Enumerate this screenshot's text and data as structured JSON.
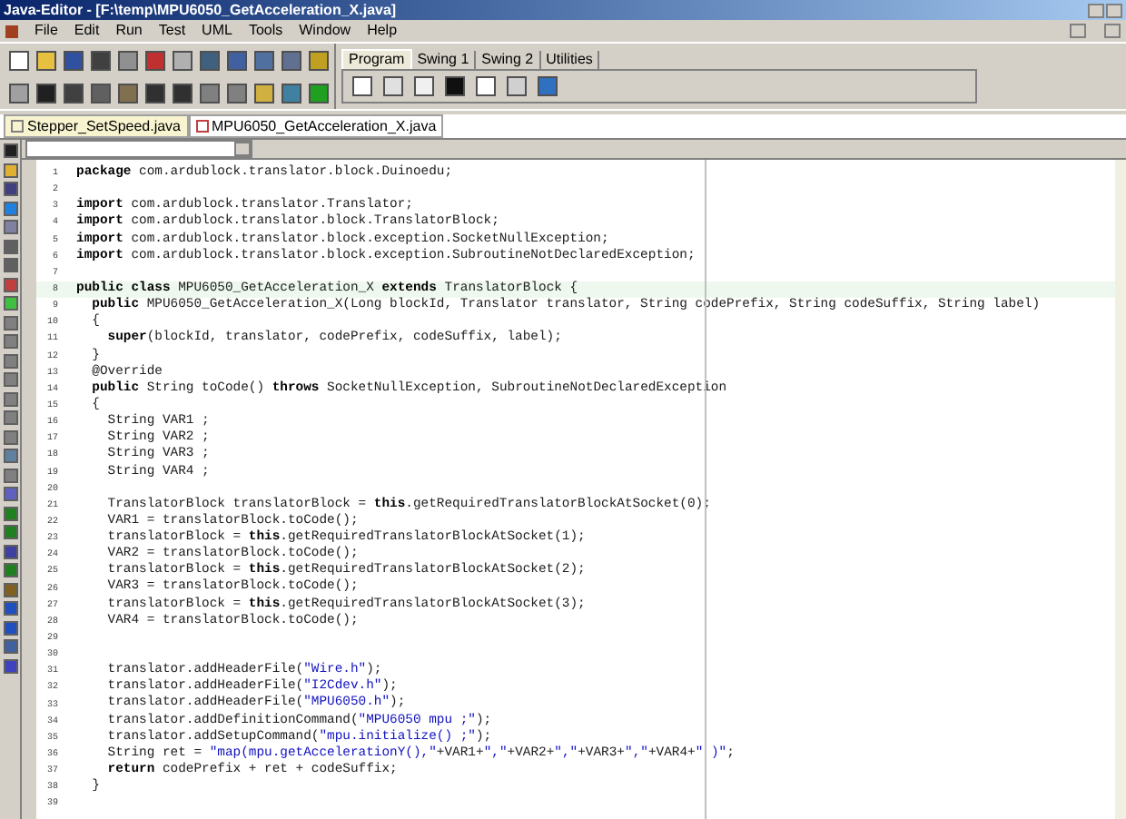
{
  "window": {
    "title": "Java-Editor - [F:\\temp\\MPU6050_GetAcceleration_X.java]"
  },
  "menu": [
    "File",
    "Edit",
    "Run",
    "Test",
    "UML",
    "Tools",
    "Window",
    "Help"
  ],
  "palette_tabs": [
    {
      "label": "Program",
      "selected": true
    },
    {
      "label": "Swing 1",
      "selected": false
    },
    {
      "label": "Swing 2",
      "selected": false
    },
    {
      "label": "Utilities",
      "selected": false
    }
  ],
  "file_tabs": [
    {
      "label": "Stepper_SetSpeed.java",
      "selected": false
    },
    {
      "label": "MPU6050_GetAcceleration_X.java",
      "selected": true
    }
  ],
  "code": [
    {
      "n": "1",
      "segs": [
        {
          "kind": "kw",
          "text": "package"
        },
        {
          "kind": "plain",
          "text": " com.ardublock.translator.block.Duinoedu;"
        }
      ]
    },
    {
      "n": "2"
    },
    {
      "n": "3",
      "segs": [
        {
          "kind": "kw",
          "text": "import"
        },
        {
          "kind": "plain",
          "text": " com.ardublock.translator.Translator;"
        }
      ]
    },
    {
      "n": "4",
      "segs": [
        {
          "kind": "kw",
          "text": "import"
        },
        {
          "kind": "plain",
          "text": " com.ardublock.translator.block.TranslatorBlock;"
        }
      ]
    },
    {
      "n": "5",
      "segs": [
        {
          "kind": "kw",
          "text": "import"
        },
        {
          "kind": "plain",
          "text": " com.ardublock.translator.block.exception.SocketNullException;"
        }
      ]
    },
    {
      "n": "6",
      "segs": [
        {
          "kind": "kw",
          "text": "import"
        },
        {
          "kind": "plain",
          "text": " com.ardublock.translator.block.exception.SubroutineNotDeclaredException;"
        }
      ]
    },
    {
      "n": "7"
    },
    {
      "n": "8",
      "segs": [
        {
          "kind": "kw",
          "text": "public class"
        },
        {
          "kind": "plain",
          "text": " MPU6050_GetAcceleration_X "
        },
        {
          "kind": "kw",
          "text": "extends"
        },
        {
          "kind": "plain",
          "text": " TranslatorBlock {"
        }
      ]
    },
    {
      "n": "9",
      "segs": [
        {
          "kind": "kw",
          "text": "  public"
        },
        {
          "kind": "plain",
          "text": " MPU6050_GetAcceleration_X(Long blockId, Translator translator, String codePrefix, String codeSuffix, String label)"
        }
      ]
    },
    {
      "n": "10",
      "segs": [
        {
          "kind": "plain",
          "text": "  {"
        }
      ]
    },
    {
      "n": "11",
      "segs": [
        {
          "kind": "kw",
          "text": "    super"
        },
        {
          "kind": "plain",
          "text": "(blockId, translator, codePrefix, codeSuffix, label);"
        }
      ]
    },
    {
      "n": "12",
      "segs": [
        {
          "kind": "plain",
          "text": "  }"
        }
      ]
    },
    {
      "n": "13",
      "segs": [
        {
          "kind": "plain",
          "text": "  @Override"
        }
      ]
    },
    {
      "n": "14",
      "segs": [
        {
          "kind": "kw",
          "text": "  public"
        },
        {
          "kind": "plain",
          "text": " String toCode() "
        },
        {
          "kind": "kw",
          "text": "throws"
        },
        {
          "kind": "plain",
          "text": " SocketNullException, SubroutineNotDeclaredException"
        }
      ]
    },
    {
      "n": "15",
      "segs": [
        {
          "kind": "plain",
          "text": "  {"
        }
      ]
    },
    {
      "n": "16",
      "segs": [
        {
          "kind": "plain",
          "text": "    String VAR1 ;"
        }
      ]
    },
    {
      "n": "17",
      "segs": [
        {
          "kind": "plain",
          "text": "    String VAR2 ;"
        }
      ]
    },
    {
      "n": "18",
      "segs": [
        {
          "kind": "plain",
          "text": "    String VAR3 ;"
        }
      ]
    },
    {
      "n": "19",
      "segs": [
        {
          "kind": "plain",
          "text": "    String VAR4 ;"
        }
      ]
    },
    {
      "n": "20"
    },
    {
      "n": "21",
      "segs": [
        {
          "kind": "plain",
          "text": "    TranslatorBlock translatorBlock = "
        },
        {
          "kind": "kw",
          "text": "this"
        },
        {
          "kind": "plain",
          "text": ".getRequiredTranslatorBlockAtSocket(0);"
        }
      ]
    },
    {
      "n": "22",
      "segs": [
        {
          "kind": "plain",
          "text": "    VAR1 = translatorBlock.toCode();"
        }
      ]
    },
    {
      "n": "23",
      "segs": [
        {
          "kind": "plain",
          "text": "    translatorBlock = "
        },
        {
          "kind": "kw",
          "text": "this"
        },
        {
          "kind": "plain",
          "text": ".getRequiredTranslatorBlockAtSocket(1);"
        }
      ]
    },
    {
      "n": "24",
      "segs": [
        {
          "kind": "plain",
          "text": "    VAR2 = translatorBlock.toCode();"
        }
      ]
    },
    {
      "n": "25",
      "segs": [
        {
          "kind": "plain",
          "text": "    translatorBlock = "
        },
        {
          "kind": "kw",
          "text": "this"
        },
        {
          "kind": "plain",
          "text": ".getRequiredTranslatorBlockAtSocket(2);"
        }
      ]
    },
    {
      "n": "26",
      "segs": [
        {
          "kind": "plain",
          "text": "    VAR3 = translatorBlock.toCode();"
        }
      ]
    },
    {
      "n": "27",
      "segs": [
        {
          "kind": "plain",
          "text": "    translatorBlock = "
        },
        {
          "kind": "kw",
          "text": "this"
        },
        {
          "kind": "plain",
          "text": ".getRequiredTranslatorBlockAtSocket(3);"
        }
      ]
    },
    {
      "n": "28",
      "segs": [
        {
          "kind": "plain",
          "text": "    VAR4 = translatorBlock.toCode();"
        }
      ]
    },
    {
      "n": "29"
    },
    {
      "n": "30"
    },
    {
      "n": "31",
      "segs": [
        {
          "kind": "plain",
          "text": "    translator.addHeaderFile("
        },
        {
          "kind": "str",
          "text": "\"Wire.h\""
        },
        {
          "kind": "plain",
          "text": ");"
        }
      ]
    },
    {
      "n": "32",
      "segs": [
        {
          "kind": "plain",
          "text": "    translator.addHeaderFile("
        },
        {
          "kind": "str",
          "text": "\"I2Cdev.h\""
        },
        {
          "kind": "plain",
          "text": ");"
        }
      ]
    },
    {
      "n": "33",
      "segs": [
        {
          "kind": "plain",
          "text": "    translator.addHeaderFile("
        },
        {
          "kind": "str",
          "text": "\"MPU6050.h\""
        },
        {
          "kind": "plain",
          "text": ");"
        }
      ]
    },
    {
      "n": "34",
      "segs": [
        {
          "kind": "plain",
          "text": "    translator.addDefinitionCommand("
        },
        {
          "kind": "str",
          "text": "\"MPU6050 mpu ;\""
        },
        {
          "kind": "plain",
          "text": ");"
        }
      ]
    },
    {
      "n": "35",
      "segs": [
        {
          "kind": "plain",
          "text": "    translator.addSetupCommand("
        },
        {
          "kind": "str",
          "text": "\"mpu.initialize() ;\""
        },
        {
          "kind": "plain",
          "text": ");"
        }
      ]
    },
    {
      "n": "36",
      "segs": [
        {
          "kind": "plain",
          "text": "    String ret = "
        },
        {
          "kind": "str",
          "text": "\"map(mpu.getAccelerationY(),\""
        },
        {
          "kind": "plain",
          "text": "+VAR1+"
        },
        {
          "kind": "str",
          "text": "\",\""
        },
        {
          "kind": "plain",
          "text": "+VAR2+"
        },
        {
          "kind": "str",
          "text": "\",\""
        },
        {
          "kind": "plain",
          "text": "+VAR3+"
        },
        {
          "kind": "str",
          "text": "\",\""
        },
        {
          "kind": "plain",
          "text": "+VAR4+"
        },
        {
          "kind": "str",
          "text": "\" )\""
        },
        {
          "kind": "plain",
          "text": ";"
        }
      ]
    },
    {
      "n": "37",
      "segs": [
        {
          "kind": "kw",
          "text": "    return"
        },
        {
          "kind": "plain",
          "text": " codePrefix + ret + codeSuffix;"
        }
      ]
    },
    {
      "n": "38",
      "segs": [
        {
          "kind": "plain",
          "text": "  }"
        }
      ]
    },
    {
      "n": "39"
    }
  ]
}
